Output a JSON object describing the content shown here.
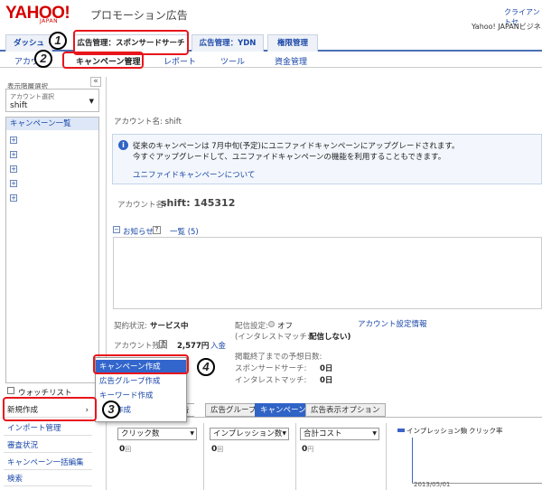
{
  "header": {
    "logo": "YAHOO!",
    "logo_sub": "JAPAN",
    "brand": "プロモーション広告",
    "client_link": "クライアントセ",
    "user": "Yahoo! JAPANビジネスI"
  },
  "tabs": [
    {
      "label": "ダッシュボ"
    },
    {
      "label": "広告管理：スポンサードサーチ"
    },
    {
      "label": "広告管理：YDN"
    },
    {
      "label": "権限管理"
    }
  ],
  "subnav": {
    "account": "アカウ",
    "campaign": "キャンペーン管理",
    "report": "レポート",
    "tools": "ツール",
    "payment": "資金管理"
  },
  "sidebar": {
    "title": "表示階層選択",
    "collapse": "«",
    "account_label": "アカウント選択",
    "account_value": "shift",
    "list_header": "キャンペーン一覧",
    "watchlist": "ウォッチリスト",
    "items": [
      "新規作成",
      "インポート管理",
      "審査状況",
      "キャンペーン一括編集",
      "検索"
    ]
  },
  "dropdown": [
    "キャンペーン作成",
    "広告グループ作成",
    "キーワード作成",
    "作成"
  ],
  "main": {
    "account_name_label": "アカウント名:",
    "account_name": "shift",
    "notice_line1": "従来のキャンペーンは 7月中旬(予定)にユニファイドキャンペーンにアップグレードされます。",
    "notice_line2": "今すぐアップグレードして、ユニファイドキャンペーンの機能を利用することもできます。",
    "notice_link": "ユニファイドキャンペーンについて",
    "account_id_label": "アカウント名:",
    "account_id": "shift: 145312",
    "news": "お知らせ",
    "news_help": "?",
    "news_list": "一覧 (5)"
  },
  "status": {
    "contract_label": "契約状況:",
    "contract_value": "サービス中",
    "balance_label": "アカウント残高",
    "balance_help": "?",
    "balance_value": "2,577円",
    "deposit": "入金",
    "delivery_label": "配信設定:",
    "delivery_value": "オフ",
    "interest_label": "(インタレストマッチ:",
    "interest_value": "配信しない)",
    "end_label": "掲載終了までの予想日数:",
    "sponsor_label": "スポンサードサーチ:",
    "sponsor_value": "0日",
    "interest2_label": "インタレストマッチ:",
    "interest2_value": "0日",
    "settings_link": "アカウント設定情報"
  },
  "main_tabs": [
    "告",
    "広告グループ",
    "キャンペーン",
    "広告表示オプション"
  ],
  "metrics": [
    {
      "label": "クリック数",
      "value": "0",
      "unit": "回"
    },
    {
      "label": "インプレッション数",
      "value": "0",
      "unit": "回"
    },
    {
      "label": "合計コスト",
      "value": "0",
      "unit": "円"
    }
  ],
  "chart_data": {
    "type": "line",
    "series": [
      {
        "name": "インプレッション数",
        "values": []
      },
      {
        "name": "クリック率",
        "values": []
      }
    ],
    "x": [
      "2013/05/01"
    ]
  },
  "annotations": [
    "1",
    "2",
    "3",
    "4"
  ]
}
